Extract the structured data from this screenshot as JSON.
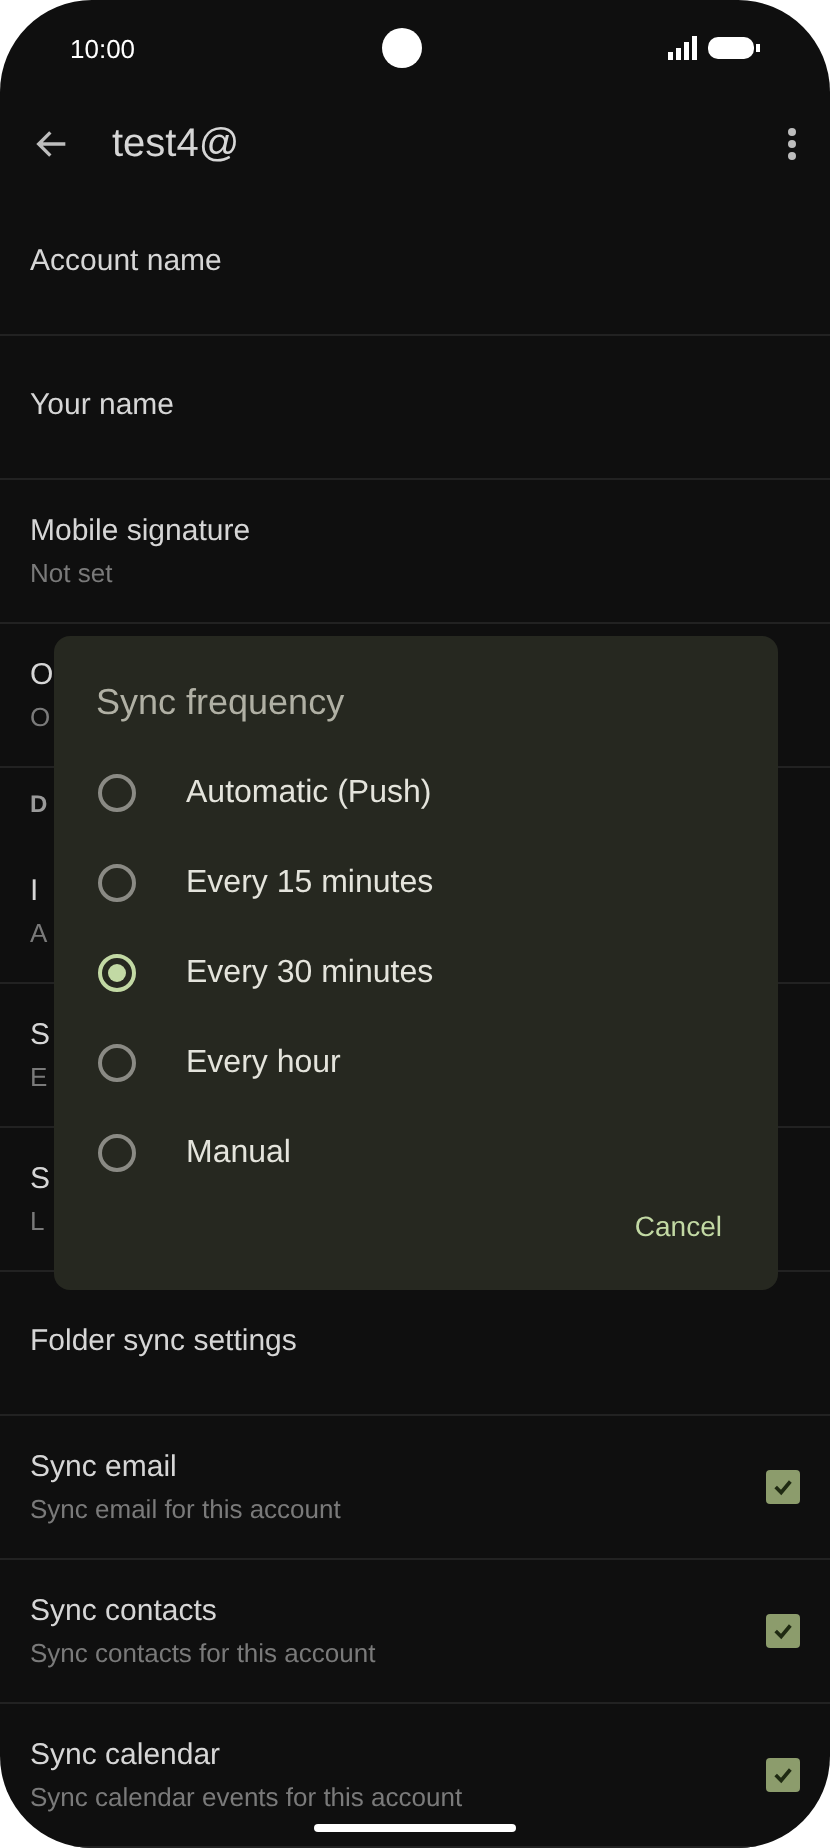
{
  "status_bar": {
    "time": "10:00"
  },
  "app_bar": {
    "title": "test4@"
  },
  "settings": [
    {
      "kind": "item",
      "title": "Account name"
    },
    {
      "kind": "item",
      "title": "Your name"
    },
    {
      "kind": "item",
      "title": "Mobile signature",
      "subtitle": "Not set"
    },
    {
      "kind": "item",
      "title": "O",
      "subtitle": "O"
    },
    {
      "kind": "header",
      "title": "D"
    },
    {
      "kind": "item",
      "title": "I",
      "subtitle": "A"
    },
    {
      "kind": "item",
      "title": "S",
      "subtitle": "E"
    },
    {
      "kind": "item",
      "title": "S",
      "subtitle": "L"
    },
    {
      "kind": "item",
      "title": "Folder sync settings"
    },
    {
      "kind": "check",
      "title": "Sync email",
      "subtitle": "Sync email for this account",
      "checked": true
    },
    {
      "kind": "check",
      "title": "Sync contacts",
      "subtitle": "Sync contacts for this account",
      "checked": true
    },
    {
      "kind": "check",
      "title": "Sync calendar",
      "subtitle": "Sync calendar events for this account",
      "checked": true
    }
  ],
  "dialog": {
    "title": "Sync frequency",
    "options": [
      {
        "label": "Automatic (Push)",
        "selected": false
      },
      {
        "label": "Every 15 minutes",
        "selected": false
      },
      {
        "label": "Every 30 minutes",
        "selected": true
      },
      {
        "label": "Every hour",
        "selected": false
      },
      {
        "label": "Manual",
        "selected": false
      }
    ],
    "cancel": "Cancel"
  }
}
